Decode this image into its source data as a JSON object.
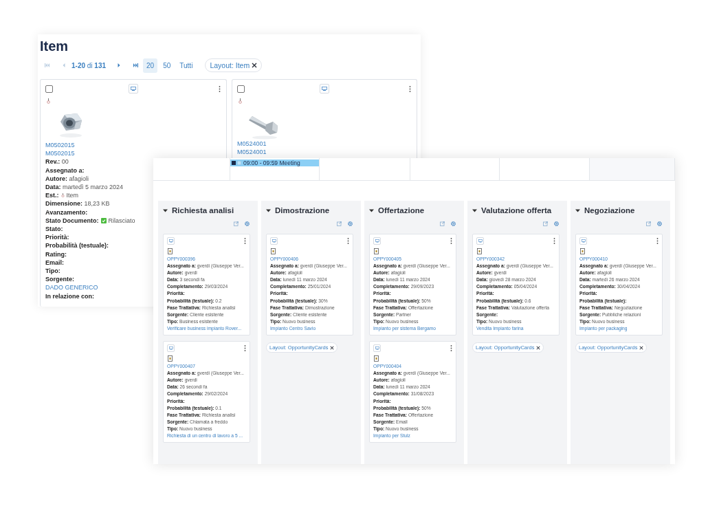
{
  "item_window": {
    "title": "Item",
    "pagination": {
      "range": "**1-20** di **131**",
      "first_disabled": true,
      "prev_disabled": true,
      "page_sizes": [
        {
          "label": "20",
          "selected": true
        },
        {
          "label": "50",
          "selected": false
        },
        {
          "label": "Tutti",
          "selected": false
        }
      ],
      "layout_chip": "Layout: Item"
    },
    "cards": [
      {
        "checked": false,
        "links": [
          "M0502015",
          "M0502015"
        ],
        "fields": [
          {
            "kind": "field",
            "label": "Rev.:",
            "value": "00"
          },
          {
            "kind": "field",
            "label": "Assegnato a:"
          },
          {
            "kind": "field",
            "label": "Autore:",
            "value": "afagioli"
          },
          {
            "kind": "field",
            "label": "Data:",
            "value": "martedì 5 marzo 2024"
          },
          {
            "kind": "type",
            "label": "Est.:",
            "value": "Item"
          },
          {
            "kind": "field",
            "label": "Dimensione:",
            "value": "18,23 KB"
          },
          {
            "kind": "field",
            "label": "Avanzamento:"
          },
          {
            "kind": "status",
            "label": "Stato Documento:",
            "value": "Rilasciato"
          },
          {
            "kind": "field",
            "label": "Stato:"
          },
          {
            "kind": "field",
            "label": "Priorità:"
          },
          {
            "kind": "field",
            "label": "Probabilità (testuale):"
          },
          {
            "kind": "field",
            "label": "Rating:"
          },
          {
            "kind": "field",
            "label": "Email:"
          },
          {
            "kind": "field",
            "label": "Tipo:"
          },
          {
            "kind": "field",
            "label": "Sorgente:"
          },
          {
            "kind": "link",
            "value": "DADO GENERICO"
          },
          {
            "kind": "field",
            "label": "In relazione con:"
          }
        ]
      },
      {
        "checked": false,
        "links": [
          "M0524001",
          "M0524001"
        ]
      }
    ]
  },
  "board_window": {
    "calendar_event": {
      "label": "09:00 - 09:59 Meeting"
    },
    "columns": [
      {
        "title": "Richiesta analisi",
        "expanded": true,
        "cards": [
          {
            "id": "OPPY000396",
            "fields": [
              {
                "label": "Assegnato a:",
                "value": "gverdi (Giuseppe Ver..."
              },
              {
                "label": "Autore:",
                "value": "gverdi"
              },
              {
                "label": "Data:",
                "value": "3 secondi fa"
              },
              {
                "label": "Completamento:",
                "value": "29/03/2024"
              },
              {
                "label": "Priorità:"
              },
              {
                "label": "Probabilità (testuale):",
                "value": "0.2"
              },
              {
                "label": "Fase Trattativa:",
                "value": "Richiesta analisi"
              },
              {
                "label": "Sorgente:",
                "value": "Cliente esistente"
              },
              {
                "label": "Tipo:",
                "value": "Business esistente"
              }
            ],
            "link": "Verificare business impianto Rover..."
          },
          {
            "id": "OPPY000407",
            "fields": [
              {
                "label": "Assegnato a:",
                "value": "gverdi (Giuseppe Ver..."
              },
              {
                "label": "Autore:",
                "value": "gverdi"
              },
              {
                "label": "Data:",
                "value": "26 secondi fa"
              },
              {
                "label": "Completamento:",
                "value": "29/02/2024"
              },
              {
                "label": "Priorità:"
              },
              {
                "label": "Probabilità (testuale):",
                "value": "0.1"
              },
              {
                "label": "Fase Trattativa:",
                "value": "Richiesta analisi"
              },
              {
                "label": "Sorgente:",
                "value": "Chiamata a freddo"
              },
              {
                "label": "Tipo:",
                "value": "Nuovo business"
              }
            ],
            "link": "Richiesta di un centro di lavoro a 5 ..."
          }
        ]
      },
      {
        "title": "Dimostrazione",
        "expanded": true,
        "layout_chip": "Layout: OpportunityCards",
        "cards": [
          {
            "id": "OPPY000406",
            "fields": [
              {
                "label": "Assegnato a:",
                "value": "gverdi (Giuseppe Ver..."
              },
              {
                "label": "Autore:",
                "value": "afagioli"
              },
              {
                "label": "Data:",
                "value": "lunedì 11 marzo 2024"
              },
              {
                "label": "Completamento:",
                "value": "25/01/2024"
              },
              {
                "label": "Priorità:"
              },
              {
                "label": "Probabilità (testuale):",
                "value": "30%"
              },
              {
                "label": "Fase Trattativa:",
                "value": "Dimostrazione"
              },
              {
                "label": "Sorgente:",
                "value": "Cliente esistente"
              },
              {
                "label": "Tipo:",
                "value": "Nuovo business"
              }
            ],
            "link": "Impianto Centro Savio"
          }
        ]
      },
      {
        "title": "Offertazione",
        "expanded": true,
        "cards": [
          {
            "id": "OPPY000405",
            "fields": [
              {
                "label": "Assegnato a:",
                "value": "gverdi (Giuseppe Ver..."
              },
              {
                "label": "Autore:",
                "value": "afagioli"
              },
              {
                "label": "Data:",
                "value": "lunedì 11 marzo 2024"
              },
              {
                "label": "Completamento:",
                "value": "29/09/2023"
              },
              {
                "label": "Priorità:"
              },
              {
                "label": "Probabilità (testuale):",
                "value": "50%"
              },
              {
                "label": "Fase Trattativa:",
                "value": "Offertazione"
              },
              {
                "label": "Sorgente:",
                "value": "Partner"
              },
              {
                "label": "Tipo:",
                "value": "Nuovo business"
              }
            ],
            "link": "Impianto per sistema Bergamo"
          },
          {
            "id": "OPPY000404",
            "fields": [
              {
                "label": "Assegnato a:",
                "value": "gverdi (Giuseppe Ver..."
              },
              {
                "label": "Autore:",
                "value": "afagioli"
              },
              {
                "label": "Data:",
                "value": "lunedì 11 marzo 2024"
              },
              {
                "label": "Completamento:",
                "value": "31/08/2023"
              },
              {
                "label": "Priorità:"
              },
              {
                "label": "Probabilità (testuale):",
                "value": "50%"
              },
              {
                "label": "Fase Trattativa:",
                "value": "Offertazione"
              },
              {
                "label": "Sorgente:",
                "value": "Email"
              },
              {
                "label": "Tipo:",
                "value": "Nuovo business"
              }
            ],
            "link": "Impianto per Stulz"
          }
        ]
      },
      {
        "title": "Valutazione offerta",
        "expanded": true,
        "layout_chip": "Layout: OpportunityCards",
        "cards": [
          {
            "id": "OPPY000342",
            "fields": [
              {
                "label": "Assegnato a:",
                "value": "gverdi (Giuseppe Ver..."
              },
              {
                "label": "Autore:",
                "value": "gverdi"
              },
              {
                "label": "Data:",
                "value": "giovedì 28 marzo 2024"
              },
              {
                "label": "Completamento:",
                "value": "05/04/2024"
              },
              {
                "label": "Priorità:"
              },
              {
                "label": "Probabilità (testuale):",
                "value": "0.6"
              },
              {
                "label": "Fase Trattativa:",
                "value": "Valutazione offerta"
              },
              {
                "label": "Sorgente:"
              },
              {
                "label": "Tipo:",
                "value": "Nuovo business"
              }
            ],
            "link": "Vendita Impianto farina"
          }
        ]
      },
      {
        "title": "Negoziazione",
        "expanded": true,
        "layout_chip": "Layout: OpportunityCards",
        "cards": [
          {
            "id": "OPPY000410",
            "fields": [
              {
                "label": "Assegnato a:",
                "value": "gverdi (Giuseppe Ver..."
              },
              {
                "label": "Autore:",
                "value": "afagioli"
              },
              {
                "label": "Data:",
                "value": "martedì 26 marzo 2024"
              },
              {
                "label": "Completamento:",
                "value": "30/04/2024"
              },
              {
                "label": "Priorità:"
              },
              {
                "label": "Probabilità (testuale):"
              },
              {
                "label": "Fase Trattativa:",
                "value": "Negoziazione"
              },
              {
                "label": "Sorgente:",
                "value": "Pubbliche relazioni"
              },
              {
                "label": "Tipo:",
                "value": "Nuovo business"
              }
            ],
            "link": "Impianto per packaging"
          }
        ]
      }
    ]
  }
}
